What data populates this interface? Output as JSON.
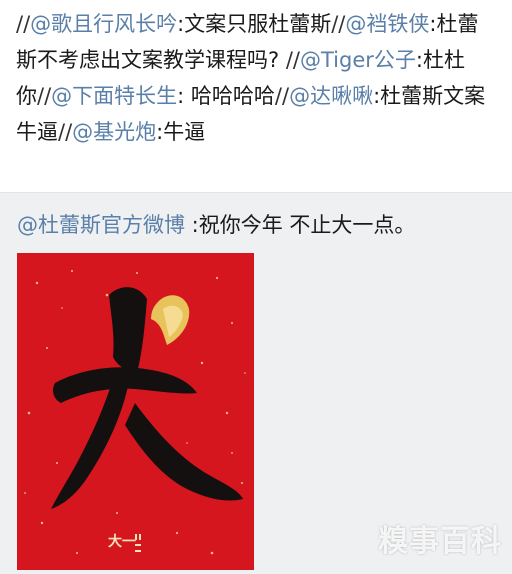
{
  "comments": {
    "line1": [
      {
        "type": "sep",
        "text": "//"
      },
      {
        "type": "mention",
        "text": "@歌且行风长吟"
      },
      {
        "type": "text",
        "text": ":文案只服杜蕾斯"
      },
      {
        "type": "sep",
        "text": "//"
      },
      {
        "type": "mention",
        "text": "@裆铁侠"
      },
      {
        "type": "text",
        "text": ":杜蕾斯不考虑出文案教学课程吗? "
      },
      {
        "type": "sep",
        "text": "//"
      },
      {
        "type": "mention",
        "text": "@Tiger公子"
      },
      {
        "type": "text",
        "text": ":杜杜你"
      },
      {
        "type": "sep",
        "text": "//"
      },
      {
        "type": "mention",
        "text": "@下面特长生"
      },
      {
        "type": "text",
        "text": ": 哈哈哈哈"
      },
      {
        "type": "sep",
        "text": "//"
      },
      {
        "type": "mention",
        "text": "@达啾啾"
      },
      {
        "type": "text",
        "text": ":杜蕾斯文案牛逼"
      },
      {
        "type": "sep",
        "text": "//"
      },
      {
        "type": "mention",
        "text": "@基光炮"
      },
      {
        "type": "text",
        "text": ":牛逼"
      }
    ]
  },
  "original_post": {
    "author": "@杜蕾斯官方微博",
    "text": " :祝你今年 不止大一点。"
  },
  "poster": {
    "big_char": "大",
    "caption": "大一",
    "bg_color": "#d5161e"
  },
  "watermark": {
    "text": "糗事百科"
  },
  "colors": {
    "mention": "#5a7fa8",
    "lower_bg": "#eef0f2"
  }
}
